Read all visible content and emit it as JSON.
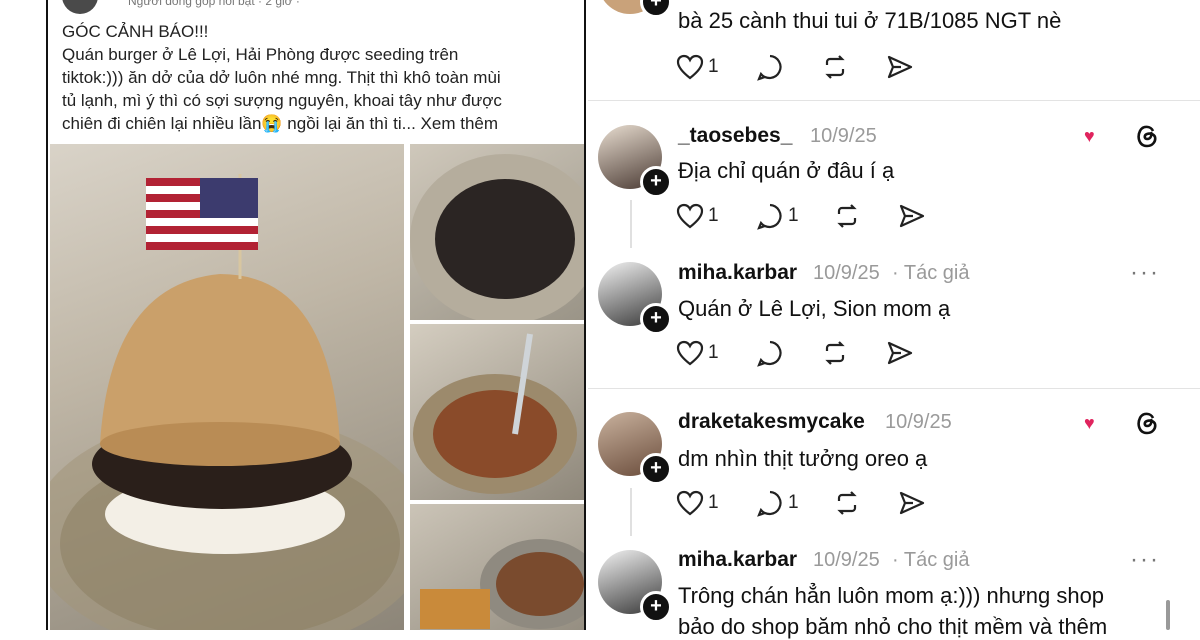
{
  "post": {
    "meta": "Người đóng góp nổi bật · 2 giờ · ",
    "text": [
      "GÓC CẢNH BÁO!!!",
      "Quán burger ở Lê Lợi, Hải Phòng được seeding trên",
      "tiktok:))) ăn dở của dở luôn nhé mng. Thịt thì khô toàn mùi",
      "tủ lạnh, mì ý thì có sợi sượng nguyên, khoai tây như được",
      "chiên đi chiên lại nhiều lần😭 ngồi lại ăn thì ti... Xem thêm"
    ]
  },
  "top_reply": {
    "comment": "bà 25 cành thui tui ở 71B/1085 NGT nè",
    "likes": "1"
  },
  "comments": [
    {
      "username": "_taosebes_",
      "date": "10/9/25",
      "text": "Địa chỉ quán ở đâu í ạ",
      "likes": "1",
      "replies": "1"
    },
    {
      "username": "miha.karbar",
      "date": "10/9/25",
      "author_tag": "· Tác giả",
      "text": "Quán ở Lê Lợi, Sion mom ạ",
      "likes": "1"
    },
    {
      "username": "draketakesmycake",
      "date": "10/9/25",
      "text": "dm nhìn thịt tưởng oreo ạ",
      "likes": "1",
      "replies": "1"
    },
    {
      "username": "miha.karbar",
      "date": "10/9/25",
      "author_tag": "· Tác giả",
      "text": "Trông chán hẳn luôn mom ạ:))) nhưng shop",
      "text2": "bảo do shop băm nhỏ cho thịt mềm và thêm"
    }
  ],
  "icons": [
    "heart-icon",
    "reply-icon",
    "repost-icon",
    "share-icon",
    "threads-icon",
    "more-icon",
    "follow-plus-icon"
  ]
}
